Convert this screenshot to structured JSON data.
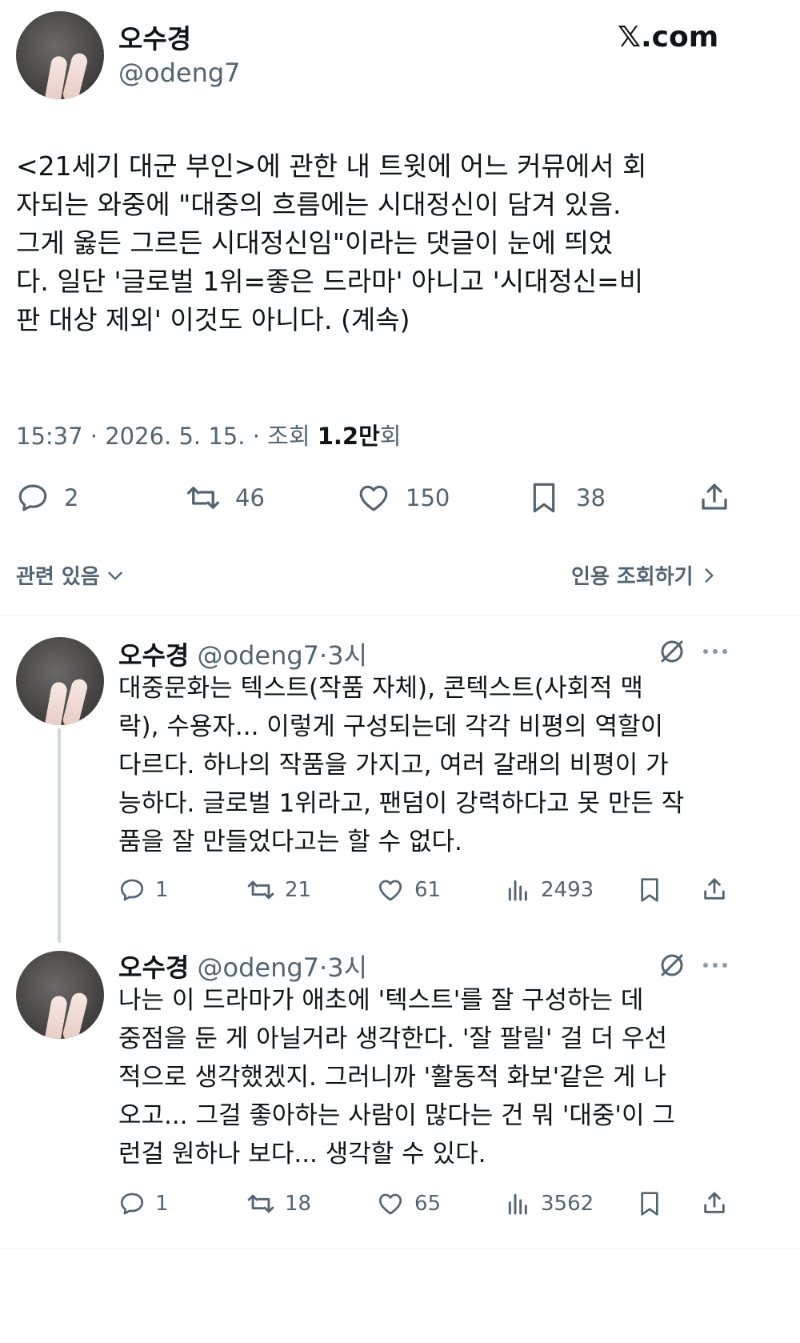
{
  "header": {
    "display_name": "오수경",
    "handle": "@odeng7",
    "site_label": "𝕏.com"
  },
  "main_tweet": {
    "text": "<21세기 대군 부인>에 관한 내 트윗에 어느 커뮤에서 회\n자되는 와중에 \"대중의 흐름에는 시대정신이 담겨 있음.\n그게 옳든 그르든 시대정신임\"이라는 댓글이 눈에 띄었\n다. 일단 '글로벌 1위=좋은 드라마' 아니고 '시대정신=비\n판 대상 제외' 이것도 아니다. (계속)",
    "time": "15:37",
    "date": "2026. 5. 15.",
    "views_prefix": "조회",
    "views_count": "1.2만",
    "views_suffix": "회",
    "separator": "·",
    "replies": "2",
    "retweets": "46",
    "likes": "150",
    "bookmarks": "38",
    "related_label": "관련 있음",
    "quote_label": "인용 조회하기"
  },
  "replies": [
    {
      "display_name": "오수경",
      "handle": "@odeng7",
      "time": "·3시",
      "text": "대중문화는 텍스트(작품 자체), 콘텍스트(사회적 맥\n락), 수용자... 이렇게 구성되는데 각각 비평의 역할이\n다르다. 하나의 작품을 가지고, 여러 갈래의 비평이 가\n능하다. 글로벌 1위라고, 팬덤이 강력하다고 못 만든 작\n품을 잘 만들었다고는 할 수 없다.",
      "replies": "1",
      "retweets": "21",
      "likes": "61",
      "views": "2493"
    },
    {
      "display_name": "오수경",
      "handle": "@odeng7",
      "time": "·3시",
      "text": "나는 이 드라마가 애초에 '텍스트'를 잘 구성하는 데\n중점을 둔 게 아닐거라 생각한다. '잘 팔릴' 걸 더 우선\n적으로 생각했겠지. 그러니까 '활동적 화보'같은 게 나\n오고... 그걸 좋아하는 사람이 많다는 건 뭐 '대중'이 그\n런걸 원하나 보다... 생각할 수 있다.",
      "replies": "1",
      "retweets": "18",
      "likes": "65",
      "views": "3562"
    }
  ],
  "icons": {
    "reply": "reply-icon",
    "retweet": "retweet-icon",
    "like": "heart-icon",
    "bookmark": "bookmark-icon",
    "share": "share-icon",
    "views": "views-icon",
    "grok": "grok-icon",
    "more": "more-icon"
  },
  "colors": {
    "text": "#0f1419",
    "muted": "#536471",
    "divider": "#eff3f4",
    "thread_line": "#cfd9de"
  }
}
